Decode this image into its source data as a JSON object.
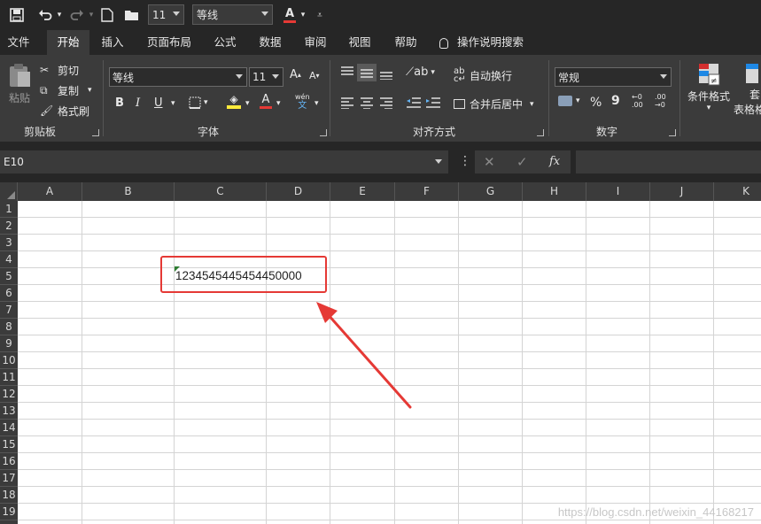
{
  "qat": {
    "font_size": "11",
    "font_name": "等线",
    "font_color_letter": "A"
  },
  "tabs": [
    "文件",
    "开始",
    "插入",
    "页面布局",
    "公式",
    "数据",
    "审阅",
    "视图",
    "帮助"
  ],
  "tell_me": "操作说明搜索",
  "ribbon": {
    "clipboard": {
      "paste": "粘贴",
      "cut": "剪切",
      "copy": "复制",
      "format_painter": "格式刷",
      "label": "剪贴板"
    },
    "font": {
      "name": "等线",
      "size": "11",
      "grow": "A",
      "shrink": "A",
      "bold": "B",
      "italic": "I",
      "underline": "U",
      "font_color": "A",
      "phonetic_top": "wén",
      "phonetic_bottom": "文",
      "label": "字体"
    },
    "alignment": {
      "wrap_text": "自动换行",
      "merge_center": "合并后居中",
      "label": "对齐方式"
    },
    "number": {
      "format": "常规",
      "percent": "%",
      "comma": "9",
      "label": "数字"
    },
    "styles": {
      "conditional": "条件格式",
      "table_top": "套",
      "table_bottom": "表格格"
    }
  },
  "formula_bar": {
    "name_box": "E10",
    "fx": "fx"
  },
  "grid": {
    "columns": [
      "A",
      "B",
      "C",
      "D",
      "E",
      "F",
      "G",
      "H",
      "I",
      "J",
      "K"
    ],
    "rows": [
      "1",
      "2",
      "3",
      "4",
      "5",
      "6",
      "7",
      "8",
      "9",
      "10",
      "11",
      "12",
      "13",
      "14",
      "15",
      "16",
      "17",
      "18",
      "19"
    ],
    "cell_c5": "1234545445454450000"
  },
  "watermark": "https://blog.csdn.net/weixin_44168217",
  "colors": {
    "accent_red": "#e53935",
    "font_color_underline": "#e53935",
    "fill_color_underline": "#ffeb3b",
    "error_flag": "#2e7d32"
  }
}
